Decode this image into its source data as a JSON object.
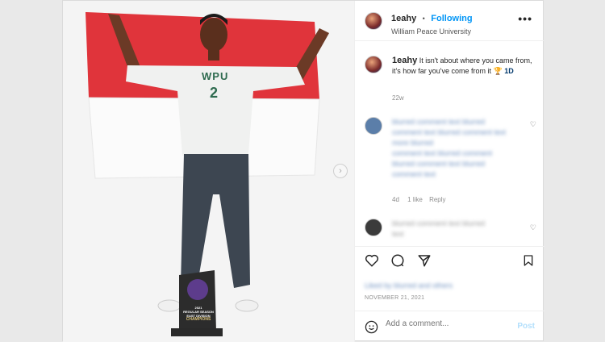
{
  "header": {
    "username": "1eahy",
    "separator": "•",
    "follow_label": "Following",
    "location": "William Peace University",
    "more_icon": "more-icon"
  },
  "caption": {
    "username": "1eahy",
    "text": "It isn't about where you came from, it's how far you've come from it 🏆",
    "text_tail": "1D",
    "time": "22w"
  },
  "comments": [
    {
      "lines": [
        "blurred comment text blurred",
        "comment text blurred comment text",
        "more blurred",
        "comment text blurred comment",
        "blurred comment text blurred",
        "comment text"
      ],
      "time": "4d",
      "likes": "1 like",
      "reply_label": "Reply"
    },
    {
      "lines": [
        "blurred comment text blurred",
        "text"
      ]
    }
  ],
  "photo": {
    "shirt_text": "WPU",
    "shirt_number": "2",
    "trophy_year": "2021",
    "trophy_line1": "REGULAR SEASON",
    "trophy_line2": "EAST DIVISION",
    "trophy_line3": "CHAMPIONS"
  },
  "actions": {
    "likes_text": "Liked by blurred and others",
    "date": "NOVEMBER 21, 2021"
  },
  "add_comment": {
    "placeholder": "Add a comment...",
    "post_label": "Post"
  },
  "colors": {
    "accent": "#0095f6",
    "flag_red": "#e0343b"
  }
}
